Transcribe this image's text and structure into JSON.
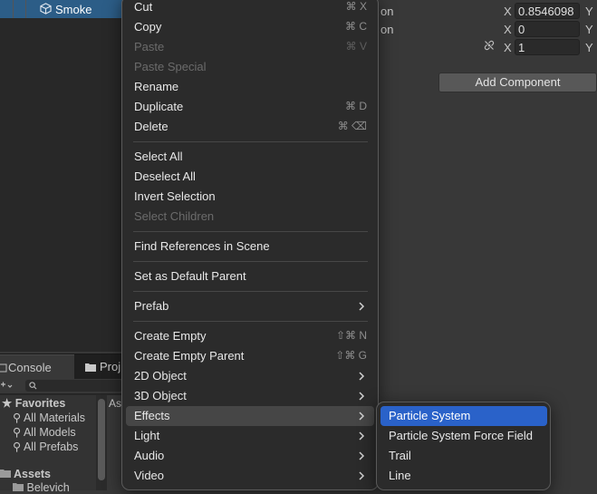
{
  "hierarchy": {
    "selected_item": "Smoke",
    "item_icon": "cube-icon"
  },
  "inspector": {
    "rows": [
      {
        "label": "on",
        "axis": "X",
        "value": "0.8546098",
        "next_axis": "Y"
      },
      {
        "label": "on",
        "axis": "X",
        "value": "0",
        "next_axis": "Y"
      },
      {
        "label": "",
        "axis": "X",
        "value": "1",
        "next_axis": "Y"
      }
    ],
    "add_component": "Add Component"
  },
  "bottom_panel": {
    "tabs": [
      "Console",
      "Proj"
    ],
    "search_icon": "search-icon",
    "tree": {
      "favorites": "Favorites",
      "fav_items": [
        "All Materials",
        "All Models",
        "All Prefabs"
      ],
      "assets": "Assets",
      "asset_child": "Belevich"
    },
    "side_label": "As"
  },
  "context_menu": {
    "items": [
      {
        "label": "Cut",
        "shortcut": "⌘ X",
        "disabled": false
      },
      {
        "label": "Copy",
        "shortcut": "⌘ C",
        "disabled": false
      },
      {
        "label": "Paste",
        "shortcut": "⌘ V",
        "disabled": true
      },
      {
        "label": "Paste Special",
        "shortcut": "",
        "disabled": true
      },
      {
        "label": "Rename",
        "shortcut": "",
        "disabled": false
      },
      {
        "label": "Duplicate",
        "shortcut": "⌘ D",
        "disabled": false
      },
      {
        "label": "Delete",
        "shortcut": "⌘ ⌫",
        "disabled": false
      },
      {
        "label": "Select All",
        "shortcut": "",
        "disabled": false
      },
      {
        "label": "Deselect All",
        "shortcut": "",
        "disabled": false
      },
      {
        "label": "Invert Selection",
        "shortcut": "",
        "disabled": false
      },
      {
        "label": "Select Children",
        "shortcut": "",
        "disabled": true
      },
      {
        "label": "Find References in Scene",
        "shortcut": "",
        "disabled": false
      },
      {
        "label": "Set as Default Parent",
        "shortcut": "",
        "disabled": false
      },
      {
        "label": "Prefab",
        "shortcut": "",
        "disabled": false,
        "submenu": true
      },
      {
        "label": "Create Empty",
        "shortcut": "⇧⌘ N",
        "disabled": false
      },
      {
        "label": "Create Empty Parent",
        "shortcut": "⇧⌘ G",
        "disabled": false
      },
      {
        "label": "2D Object",
        "shortcut": "",
        "disabled": false,
        "submenu": true
      },
      {
        "label": "3D Object",
        "shortcut": "",
        "disabled": false,
        "submenu": true
      },
      {
        "label": "Effects",
        "shortcut": "",
        "disabled": false,
        "submenu": true,
        "highlighted": true
      },
      {
        "label": "Light",
        "shortcut": "",
        "disabled": false,
        "submenu": true
      },
      {
        "label": "Audio",
        "shortcut": "",
        "disabled": false,
        "submenu": true
      },
      {
        "label": "Video",
        "shortcut": "",
        "disabled": false,
        "submenu": true
      }
    ]
  },
  "effects_submenu": {
    "items": [
      {
        "label": "Particle System",
        "selected": true
      },
      {
        "label": "Particle System Force Field",
        "selected": false
      },
      {
        "label": "Trail",
        "selected": false
      },
      {
        "label": "Line",
        "selected": false
      }
    ]
  },
  "colors": {
    "selection_blue": "#2a62c9",
    "hierarchy_selection": "#2c5d87",
    "menu_bg": "#2b2b2b"
  }
}
